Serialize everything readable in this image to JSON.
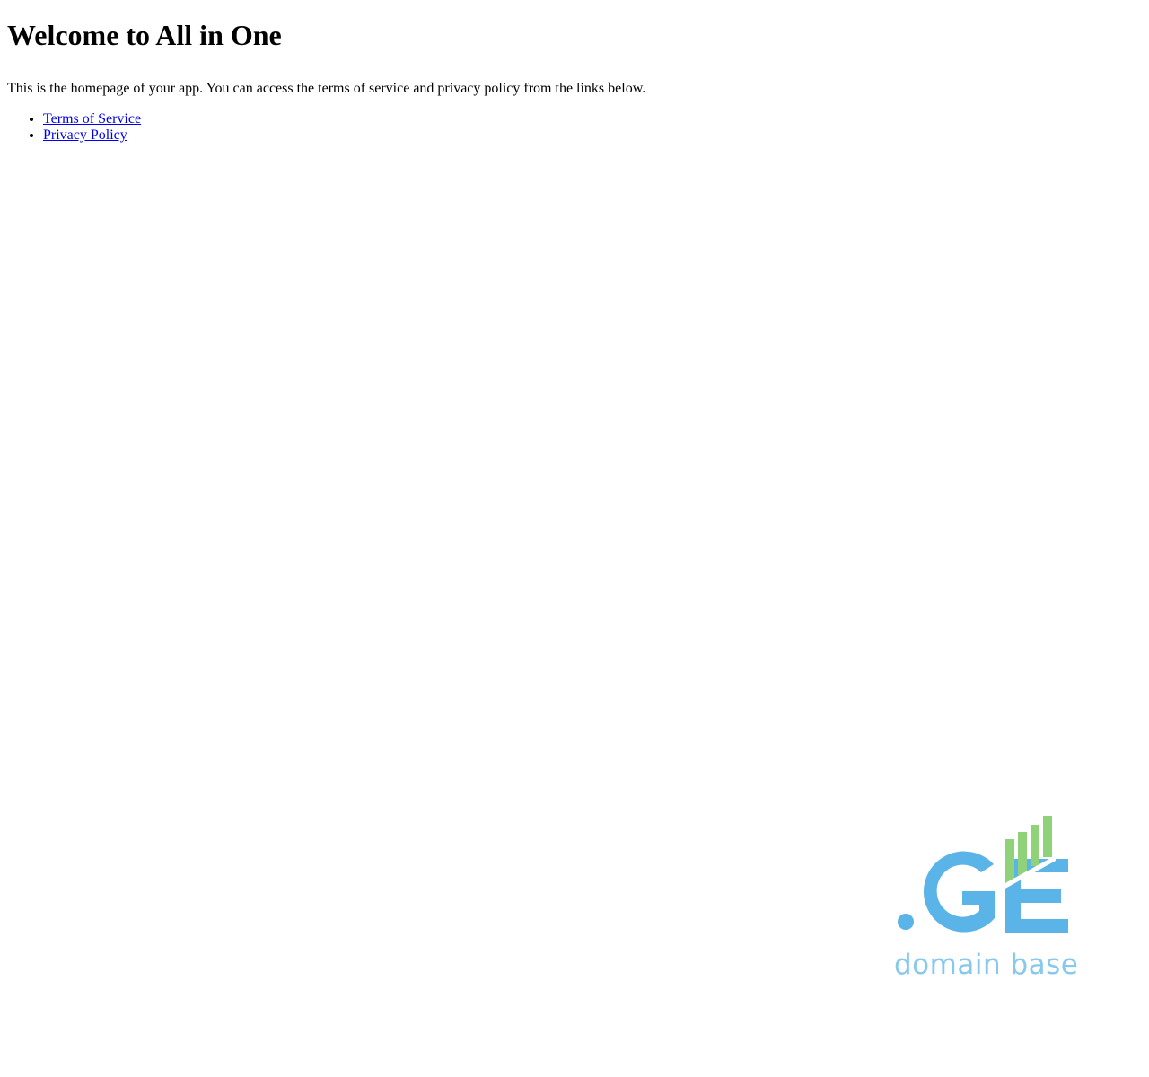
{
  "page": {
    "heading": "Welcome to All in One",
    "intro": "This is the homepage of your app. You can access the terms of service and privacy policy from the links below."
  },
  "links": [
    {
      "label": "Terms of Service"
    },
    {
      "label": "Privacy Policy"
    }
  ],
  "brand": {
    "logo_text": ".GE",
    "tagline": "domain base",
    "colors": {
      "primary_blue": "#5bb4e8",
      "light_blue": "#87c8ed",
      "green": "#8fd27a"
    }
  }
}
